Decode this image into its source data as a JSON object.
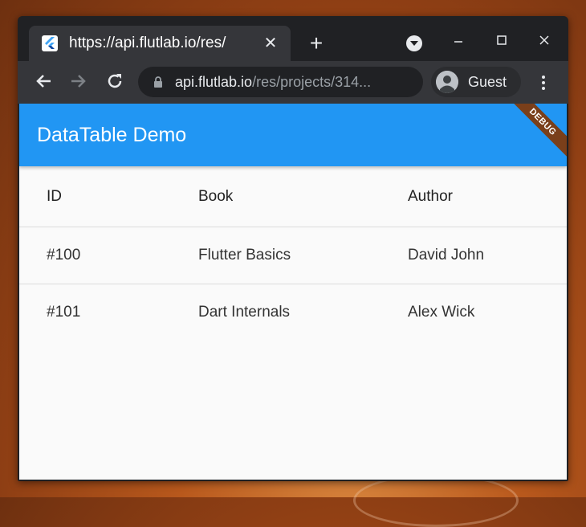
{
  "browser": {
    "tab_title": "https://api.flutlab.io/res/",
    "new_tab_label": "+",
    "tab_close_label": "✕",
    "url_host": "api.flutlab.io",
    "url_path": "/res/projects/314...",
    "profile_name": "Guest"
  },
  "app": {
    "title": "DataTable Demo",
    "debug_banner": "DEBUG",
    "accent_color": "#2196f3"
  },
  "table": {
    "columns": [
      "ID",
      "Book",
      "Author"
    ],
    "rows": [
      [
        "#100",
        "Flutter Basics",
        "David John"
      ],
      [
        "#101",
        "Dart Internals",
        "Alex Wick"
      ]
    ]
  }
}
